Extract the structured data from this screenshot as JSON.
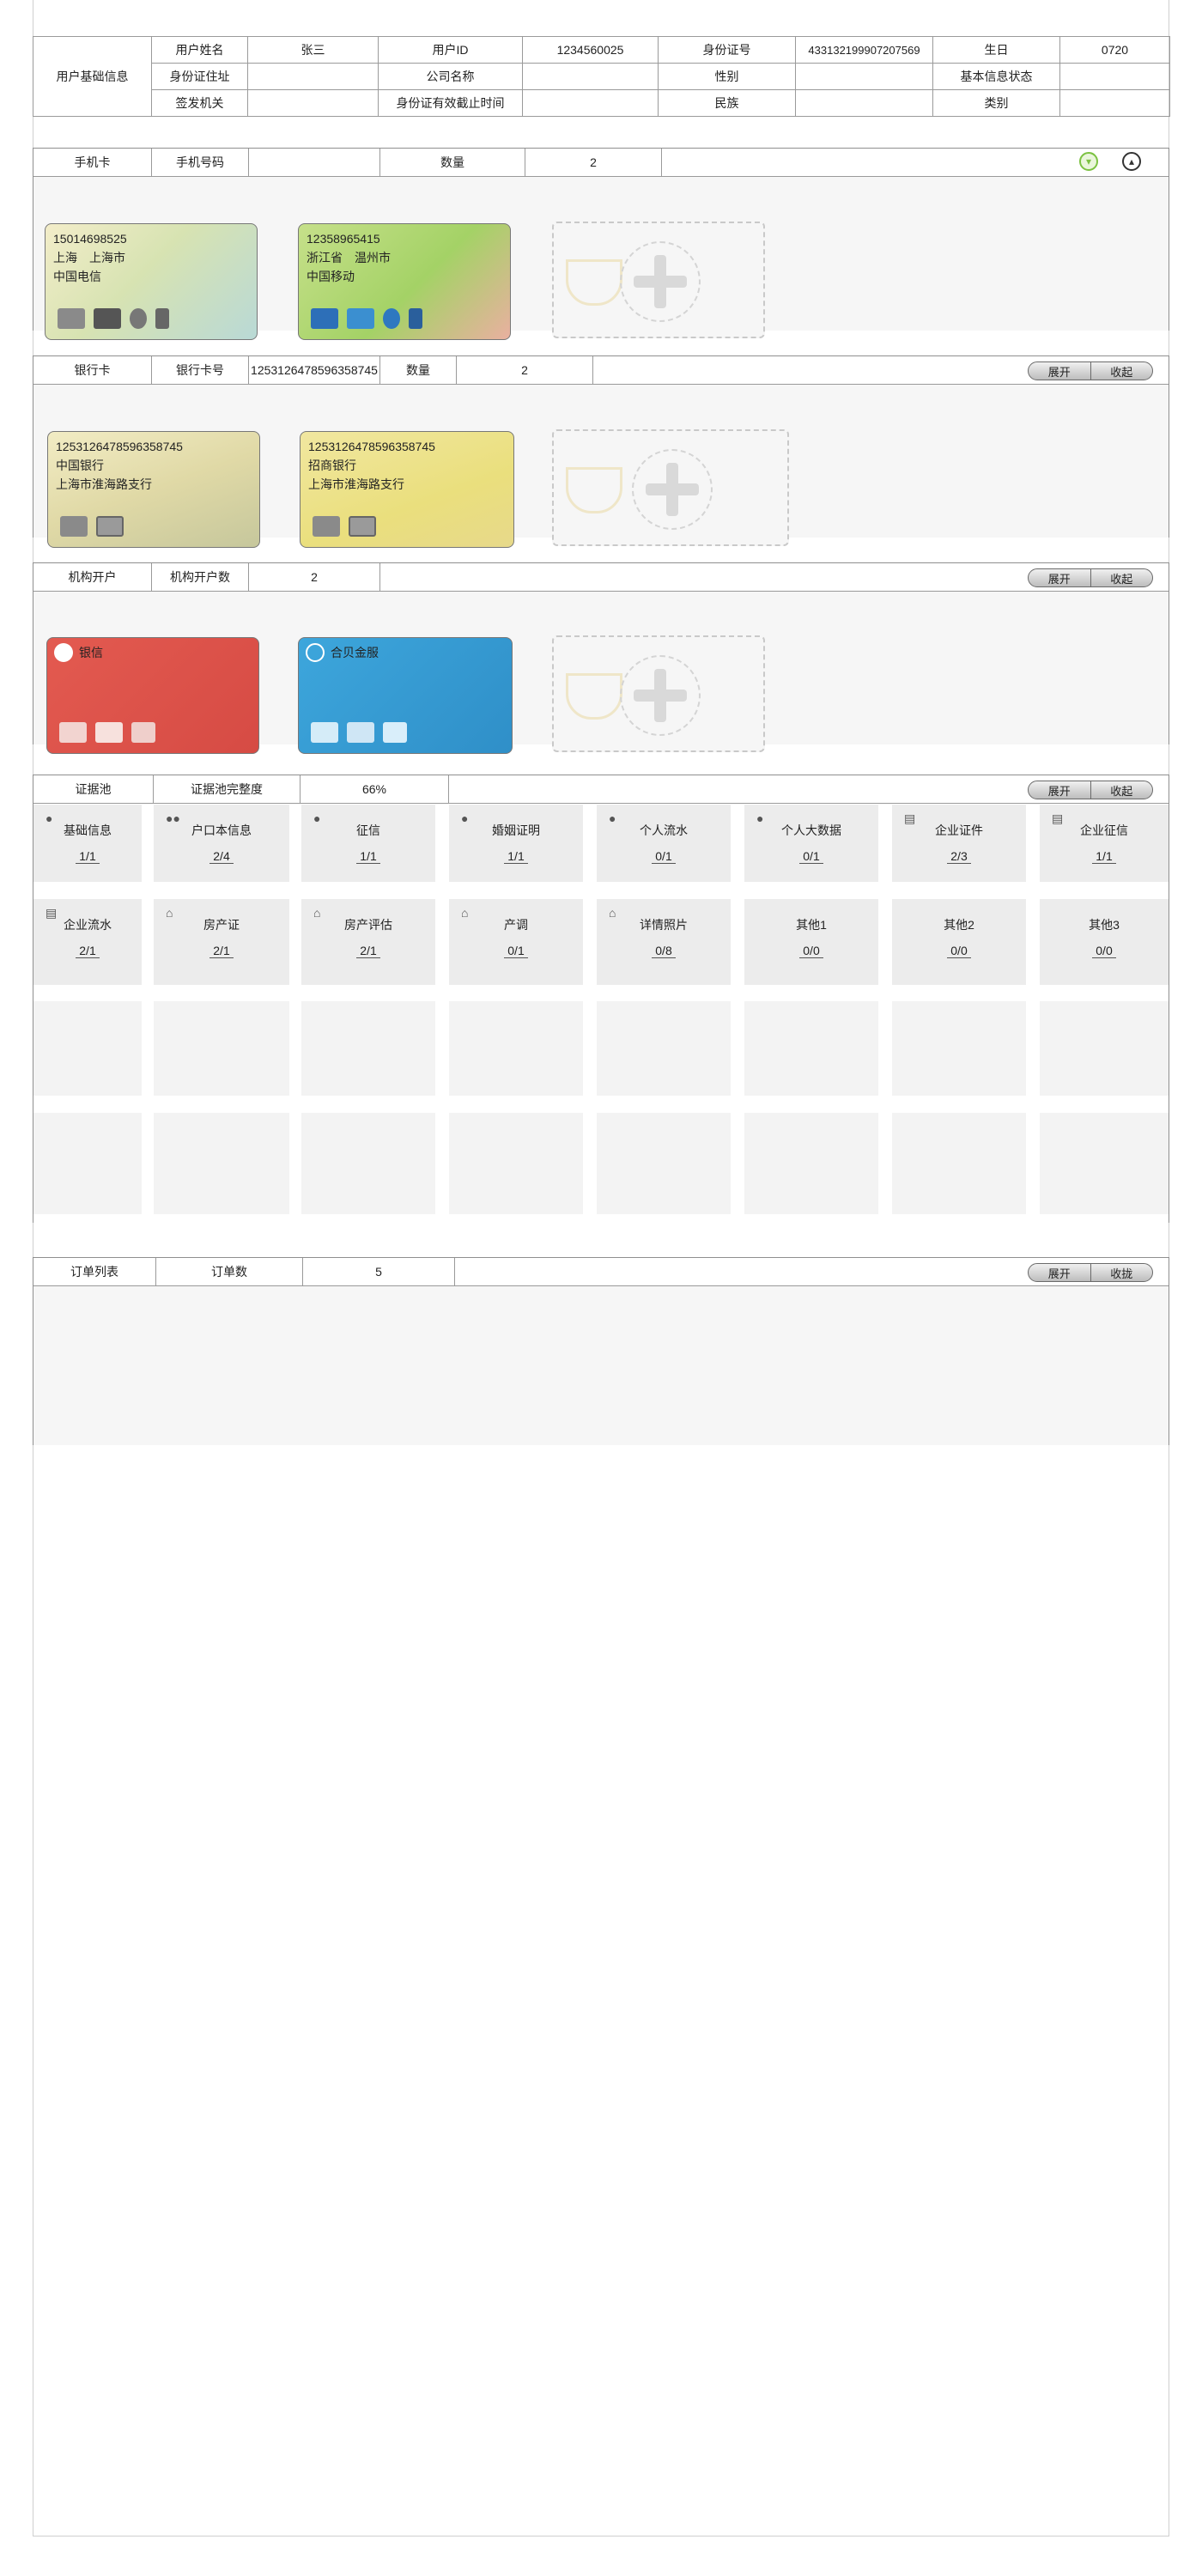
{
  "basic": {
    "section_label": "用户基础信息",
    "rows": [
      [
        "用户姓名",
        "张三",
        "用户ID",
        "1234560025",
        "身份证号",
        "433132199907207569",
        "生日",
        "0720"
      ],
      [
        "身份证住址",
        "",
        "公司名称",
        "",
        "性别",
        "",
        "基本信息状态",
        ""
      ],
      [
        "签发机关",
        "",
        "身份证有效截止时间",
        "",
        "民族",
        "",
        "类别",
        ""
      ]
    ]
  },
  "phone": {
    "label": "手机卡",
    "number_label": "手机号码",
    "number_value": "",
    "count_label": "数量",
    "count_value": "2",
    "cards": [
      {
        "number": "15014698525",
        "region": "上海　上海市",
        "carrier": "中国电信"
      },
      {
        "number": "12358965415",
        "region": "浙江省　温州市",
        "carrier": "中国移动"
      }
    ]
  },
  "bank": {
    "label": "银行卡",
    "number_label": "银行卡号",
    "number_value": "1253126478596358745",
    "count_label": "数量",
    "count_value": "2",
    "expand": "展开",
    "collapse": "收起",
    "cards": [
      {
        "number": "1253126478596358745",
        "bank": "中国银行",
        "branch": "上海市淮海路支行"
      },
      {
        "number": "1253126478596358745",
        "bank": "招商银行",
        "branch": "上海市淮海路支行"
      }
    ]
  },
  "org": {
    "label": "机构开户",
    "count_label": "机构开户数",
    "count_value": "2",
    "expand": "展开",
    "collapse": "收起",
    "cards": [
      {
        "name": "银信"
      },
      {
        "name": "合贝金服"
      }
    ]
  },
  "evidence": {
    "label": "证据池",
    "completeness_label": "证据池完整度",
    "completeness_value": "66%",
    "expand": "展开",
    "collapse": "收起",
    "row1": [
      {
        "title": "基础信息",
        "value": "1/1"
      },
      {
        "title": "户口本信息",
        "value": "2/4"
      },
      {
        "title": "征信",
        "value": "1/1"
      },
      {
        "title": "婚姻证明",
        "value": "1/1"
      },
      {
        "title": "个人流水",
        "value": "0/1"
      },
      {
        "title": "个人大数据",
        "value": "0/1"
      },
      {
        "title": "企业证件",
        "value": "2/3"
      },
      {
        "title": "企业征信",
        "value": "1/1"
      }
    ],
    "row2": [
      {
        "title": "企业流水",
        "value": "2/1"
      },
      {
        "title": "房产证",
        "value": "2/1"
      },
      {
        "title": "房产评估",
        "value": "2/1"
      },
      {
        "title": "产调",
        "value": "0/1"
      },
      {
        "title": "详情照片",
        "value": "0/8"
      },
      {
        "title": "其他1",
        "value": "0/0"
      },
      {
        "title": "其他2",
        "value": "0/0"
      },
      {
        "title": "其他3",
        "value": "0/0"
      }
    ]
  },
  "orders": {
    "label": "订单列表",
    "count_label": "订单数",
    "count_value": "5",
    "expand": "展开",
    "collapse": "收拢"
  },
  "colors": {
    "telecom_card": "#dfe3b8",
    "mobile_card": "#a9d36a",
    "boc_card": "#e8e2b0",
    "cmb_card": "#ece27a",
    "yinxin_card": "#e0584f",
    "hebei_card": "#3b9fd6",
    "down_btn": "#7cc242",
    "up_btn": "#333333"
  }
}
